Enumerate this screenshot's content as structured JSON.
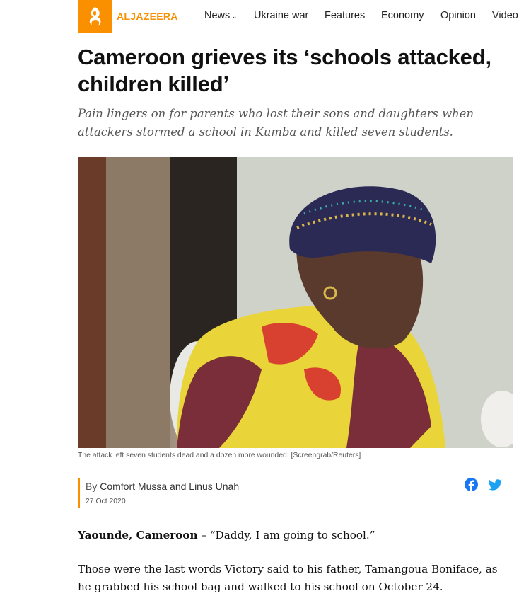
{
  "header": {
    "logo_text": "ALJAZEERA",
    "accent_color": "#fa9000",
    "nav": [
      {
        "label": "News",
        "has_dropdown": true
      },
      {
        "label": "Ukraine war"
      },
      {
        "label": "Features"
      },
      {
        "label": "Economy"
      },
      {
        "label": "Opinion"
      },
      {
        "label": "Video"
      }
    ]
  },
  "article": {
    "headline": "Cameroon grieves its ‘schools attacked, children killed’",
    "subhead": "Pain lingers on for parents who lost their sons and daughters when attackers stormed a school in Kumba and killed seven students.",
    "image_caption": "The attack left seven students dead and a dozen more wounded. [Screengrab/Reuters]",
    "byline_prefix": "By",
    "byline_authors": "Comfort Mussa and Linus Unah",
    "date": "27 Oct 2020",
    "share": {
      "facebook_icon": "facebook-icon",
      "twitter_icon": "twitter-icon"
    },
    "dateline": "Yaounde, Cameroon",
    "p1_rest": " – “Daddy, I am going to school.”",
    "p2": "Those were the last words Victory said to his father, Tamangoua Boniface, as he grabbed his school bag and walked to his school on October 24."
  }
}
